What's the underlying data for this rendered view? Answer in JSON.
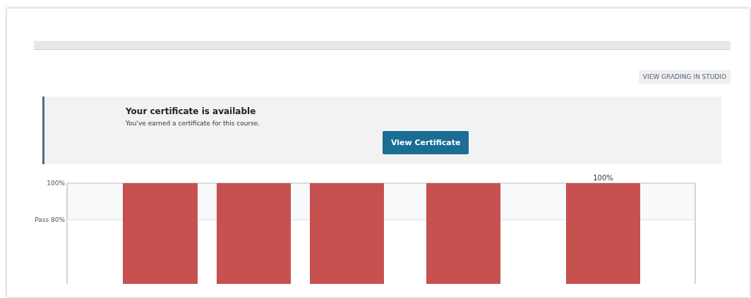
{
  "header": {
    "studio_button": "VIEW GRADING IN STUDIO"
  },
  "certificate_banner": {
    "title": "Your certificate is available",
    "message": "You've earned a certificate for this course.",
    "button": "View Certificate"
  },
  "grade_chart": {
    "y_axis_labels": [
      "100%",
      "Pass 80%"
    ],
    "last_bar_label": "100%"
  }
}
